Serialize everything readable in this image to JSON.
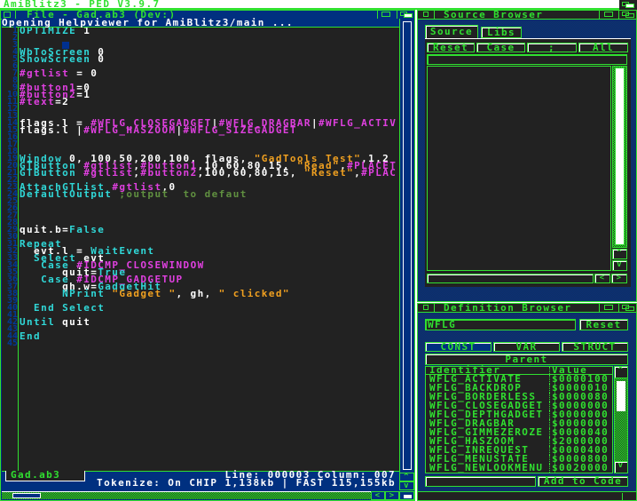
{
  "screen_title": "AmiBlitz3 - PED V3.9.7",
  "editor": {
    "title": "File - Gad.ab3 (Dev:)",
    "message": "Opening Helpviewer for AmiBlitz3/main ...",
    "lines": [
      [
        [
          "k",
          "OPTIMIZE"
        ],
        [
          "w",
          " 1"
        ]
      ],
      [],
      [],
      [
        [
          "k",
          "WbToScreen"
        ],
        [
          "w",
          " 0"
        ]
      ],
      [
        [
          "k",
          "ShowScreen"
        ],
        [
          "w",
          " 0"
        ]
      ],
      [],
      [
        [
          "m",
          "#gtlist"
        ],
        [
          "w",
          " = 0"
        ]
      ],
      [],
      [
        [
          "m",
          "#button1"
        ],
        [
          "w",
          "=0"
        ]
      ],
      [
        [
          "m",
          "#button2"
        ],
        [
          "w",
          "=1"
        ]
      ],
      [
        [
          "m",
          "#text"
        ],
        [
          "w",
          "=2"
        ]
      ],
      [],
      [],
      [
        [
          "w",
          "flags.l = "
        ],
        [
          "m",
          "#WFLG_CLOSEGADGET"
        ],
        [
          "w",
          "|"
        ],
        [
          "m",
          "#WFLG_DRAGBAR"
        ],
        [
          "w",
          "|"
        ],
        [
          "m",
          "#WFLG_ACTIV"
        ]
      ],
      [
        [
          "w",
          "flags.l |"
        ],
        [
          "m",
          "#WFLG_HASZOOM"
        ],
        [
          "w",
          "|"
        ],
        [
          "m",
          "#WFLG_SIZEGADGET"
        ]
      ],
      [],
      [],
      [],
      [
        [
          "k",
          "Window"
        ],
        [
          "w",
          " 0, 100,50,200,100, flags, "
        ],
        [
          "o",
          "\"GadTools Test\""
        ],
        [
          "w",
          ",1,2"
        ]
      ],
      [
        [
          "k",
          "GTButton"
        ],
        [
          "w",
          " "
        ],
        [
          "m",
          "#gtlist"
        ],
        [
          "w",
          ","
        ],
        [
          "m",
          "#button1"
        ],
        [
          "w",
          ",10,60,80,15, "
        ],
        [
          "o",
          "\"Read\""
        ],
        [
          "w",
          ","
        ],
        [
          "m",
          "#PLACET"
        ]
      ],
      [
        [
          "k",
          "GTButton"
        ],
        [
          "w",
          " "
        ],
        [
          "m",
          "#gtlist"
        ],
        [
          "w",
          ","
        ],
        [
          "m",
          "#button2"
        ],
        [
          "w",
          ",100,60,80,15, "
        ],
        [
          "o",
          "\"Reset\""
        ],
        [
          "w",
          ","
        ],
        [
          "m",
          "#PLAC"
        ]
      ],
      [],
      [
        [
          "k",
          "AttachGTList"
        ],
        [
          "w",
          " "
        ],
        [
          "m",
          "#gtlist"
        ],
        [
          "w",
          ",0"
        ]
      ],
      [
        [
          "k",
          "DefaultOutput"
        ],
        [
          "w",
          " "
        ],
        [
          "c",
          ";output  to defaut"
        ]
      ],
      [],
      [],
      [],
      [],
      [
        [
          "w",
          "quit.b="
        ],
        [
          "k",
          "False"
        ]
      ],
      [],
      [
        [
          "k",
          "Repeat"
        ]
      ],
      [
        [
          "w",
          "  evt.l = "
        ],
        [
          "k",
          "WaitEvent"
        ]
      ],
      [
        [
          "w",
          "  "
        ],
        [
          "k",
          "Select"
        ],
        [
          "w",
          " evt"
        ]
      ],
      [
        [
          "w",
          "   "
        ],
        [
          "k",
          "Case"
        ],
        [
          "w",
          " "
        ],
        [
          "m",
          "#IDCMP_CLOSEWINDOW"
        ]
      ],
      [
        [
          "w",
          "      quit="
        ],
        [
          "k",
          "True"
        ]
      ],
      [
        [
          "w",
          "   "
        ],
        [
          "k",
          "Case"
        ],
        [
          "w",
          " "
        ],
        [
          "m",
          "#IDCMP_GADGETUP"
        ]
      ],
      [
        [
          "w",
          "      gh.w="
        ],
        [
          "k",
          "GadgetHit"
        ]
      ],
      [
        [
          "w",
          "      "
        ],
        [
          "k",
          "NPrint"
        ],
        [
          "w",
          " "
        ],
        [
          "o",
          "\"Gadget \""
        ],
        [
          "w",
          ", gh, "
        ],
        [
          "o",
          "\" clicked\""
        ]
      ],
      [],
      [
        [
          "w",
          "  "
        ],
        [
          "k",
          "End Select"
        ]
      ],
      [],
      [
        [
          "k",
          "Until"
        ],
        [
          "w",
          " quit"
        ]
      ],
      [],
      [
        [
          "k",
          "End"
        ]
      ],
      []
    ],
    "file_tab": "Gad.ab3",
    "status_line": "Line: 000003 Column: 007",
    "status_info": "Tokenize: On  CHIP 1,138kb | FAST 115,155kb"
  },
  "source_browser": {
    "title": "Source Browser",
    "tabs": [
      "Source",
      "Libs"
    ],
    "buttons": [
      "Reset",
      "Case",
      ";",
      "All"
    ],
    "filter_value": "",
    "bottom_value": ""
  },
  "definition_browser": {
    "title": "Definition Browser",
    "search_value": "WFLG",
    "reset": "Reset",
    "tabs": [
      "CONST",
      "VAR",
      "STRUCT"
    ],
    "active_tab": "CONST",
    "parent": "Parent",
    "headers": [
      "Identifier",
      "Value"
    ],
    "rows": [
      [
        "WFLG_ACTIVATE",
        "$0000100"
      ],
      [
        "WFLG_BACKDROP",
        "$0000010"
      ],
      [
        "WFLG_BORDERLESS",
        "$0000080"
      ],
      [
        "WFLG_CLOSEGADGET",
        "$0000000"
      ],
      [
        "WFLG_DEPTHGADGET",
        "$0000000"
      ],
      [
        "WFLG_DRAGBAR",
        "$0000000"
      ],
      [
        "WFLG_GIMMEZEROZE",
        "$0000040"
      ],
      [
        "WFLG_HASZOOM",
        "$2000000"
      ],
      [
        "WFLG_INREQUEST",
        "$0000400"
      ],
      [
        "WFLG_MENUSTATE",
        "$0000800"
      ],
      [
        "WFLG_NEWLOOKMENU",
        "$0020000"
      ]
    ],
    "add_button": "Add to Code"
  },
  "colors": {
    "accent": "#30e030",
    "window": "#003080",
    "background": "#222222"
  }
}
